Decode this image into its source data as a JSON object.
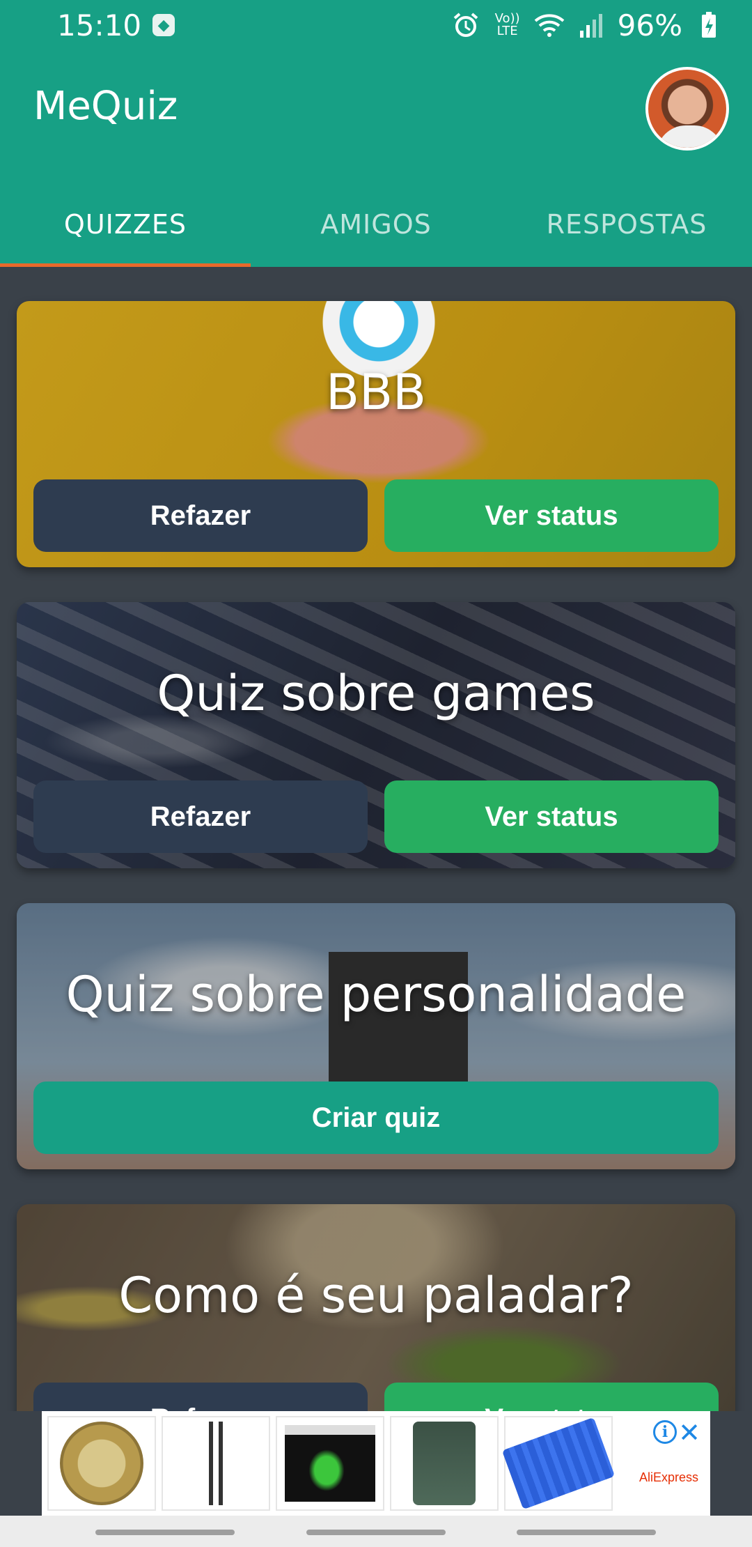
{
  "status_bar": {
    "time": "15:10",
    "battery": "96%",
    "volte_label": "Vo)) LTE"
  },
  "app": {
    "title": "MeQuiz"
  },
  "tabs": [
    {
      "label": "QUIZZES",
      "active": true
    },
    {
      "label": "AMIGOS",
      "active": false
    },
    {
      "label": "RESPOSTAS",
      "active": false
    }
  ],
  "quizzes": [
    {
      "title": "BBB",
      "left_button": "Refazer",
      "right_button": "Ver status"
    },
    {
      "title": "Quiz sobre games",
      "left_button": "Refazer",
      "right_button": "Ver status"
    },
    {
      "title": "Quiz sobre personalidade",
      "full_button": "Criar quiz"
    },
    {
      "title": "Como é seu paladar?",
      "left_button": "Refazer",
      "right_button": "Ver status"
    }
  ],
  "ad": {
    "brand": "AliExpress",
    "info_icon": "i",
    "close_icon": "✕"
  },
  "colors": {
    "primary": "#17a085",
    "tab_indicator": "#e8692b",
    "button_dark": "#2e3c50",
    "button_green": "#27ae60",
    "background": "#3a4149"
  }
}
